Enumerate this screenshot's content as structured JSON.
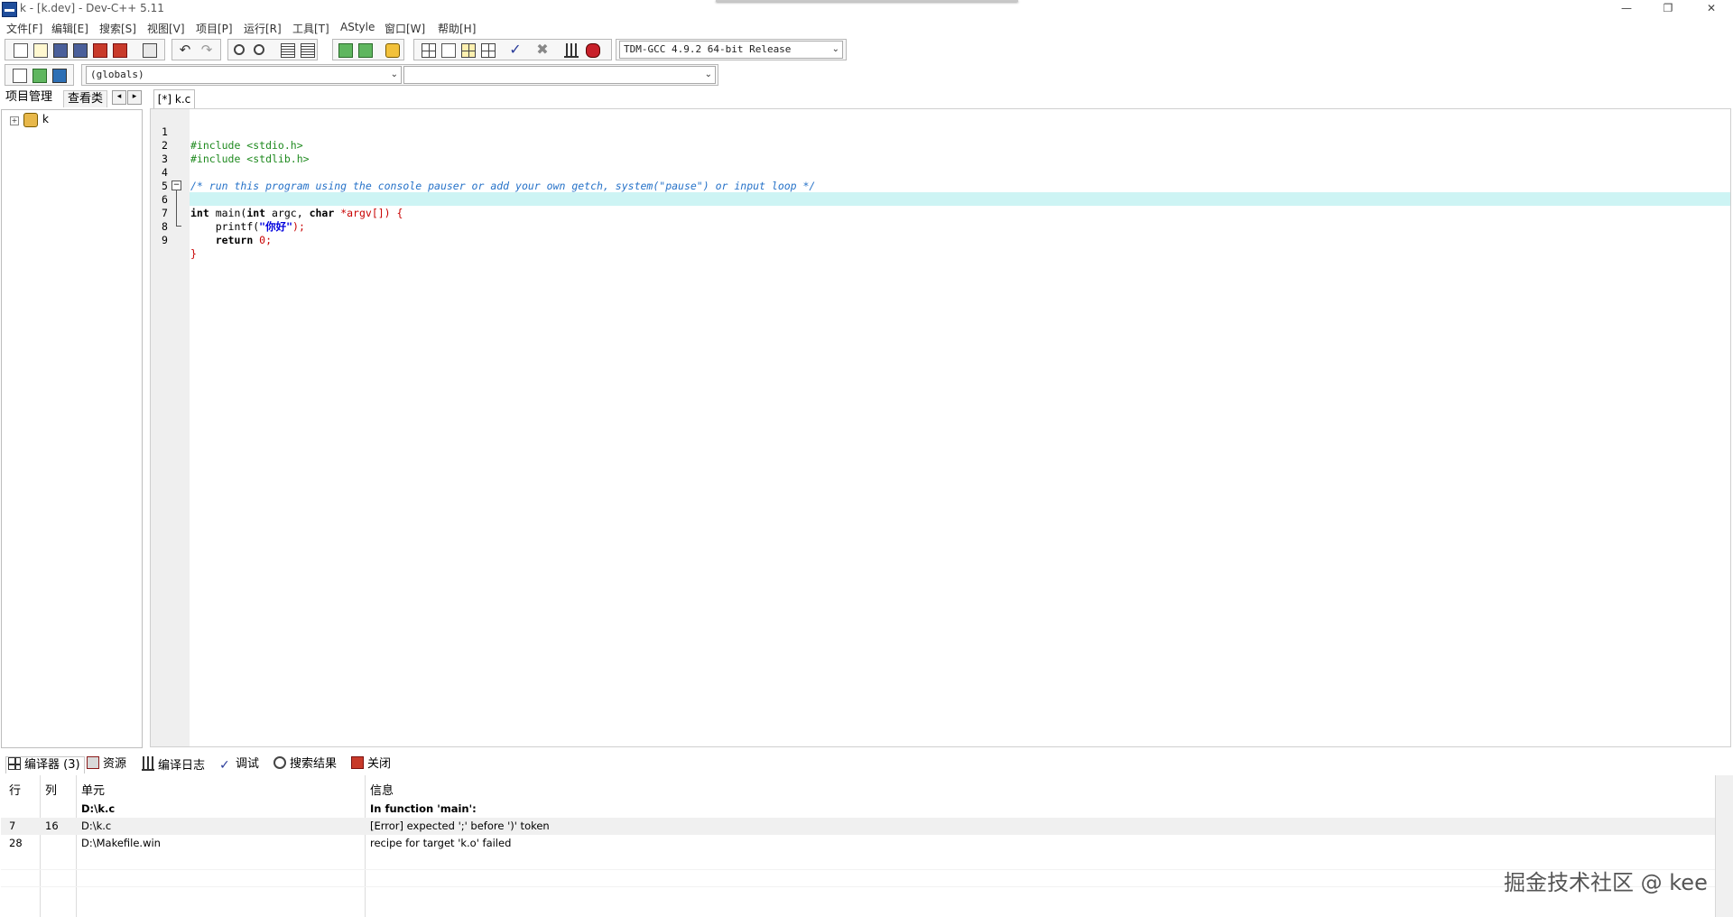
{
  "window": {
    "title": "k - [k.dev] - Dev-C++ 5.11",
    "minimize": "—",
    "restore": "❐",
    "close": "✕"
  },
  "menu": [
    "文件[F]",
    "编辑[E]",
    "搜索[S]",
    "视图[V]",
    "项目[P]",
    "运行[R]",
    "工具[T]",
    "AStyle",
    "窗口[W]",
    "帮助[H]"
  ],
  "toolbar": {
    "compiler_select": "TDM-GCC 4.9.2 64-bit Release",
    "class_select": "(globals)",
    "member_select": ""
  },
  "left_panel": {
    "tabs": [
      "项目管理",
      "查看类"
    ],
    "nav_prev": "◂",
    "nav_next": "▸",
    "tree": {
      "expander": "+",
      "project": "k"
    }
  },
  "editor": {
    "tab": "[*] k.c",
    "line_numbers": [
      "1",
      "2",
      "3",
      "4",
      "5",
      "6",
      "7",
      "8",
      "9"
    ],
    "lines": {
      "l1": "#include <stdio.h>",
      "l2": "#include <stdlib.h>",
      "l4": "/* run this program using the console pauser or add your own getch, system(\"pause\") or input loop */",
      "l6_kw1": "int",
      "l6_a": " main(",
      "l6_kw2": "int",
      "l6_b": " argc, ",
      "l6_kw3": "char",
      "l6_c": " *argv[]) {",
      "l7_indent": "    ",
      "l7_fn": "printf(",
      "l7_str": "\"你好\"",
      "l7_end": ");",
      "l8_indent": "    ",
      "l8_kw": "return",
      "l8_num": " 0;",
      "l9": "}"
    },
    "fold_marker": "−"
  },
  "bottom_panel": {
    "tabs": [
      "编译器 (3)",
      "资源",
      "编译日志",
      "调试",
      "搜索结果",
      "关闭"
    ],
    "columns": [
      "行",
      "列",
      "单元",
      "信息"
    ],
    "rows": [
      {
        "line": "",
        "col": "",
        "unit": "D:\\k.c",
        "message": "In function 'main':"
      },
      {
        "line": "7",
        "col": "16",
        "unit": "D:\\k.c",
        "message": "[Error] expected ';' before ')' token"
      },
      {
        "line": "28",
        "col": "",
        "unit": "D:\\Makefile.win",
        "message": "recipe for target 'k.o' failed"
      }
    ]
  },
  "watermark": "掘金技术社区 @ kee",
  "colors": {
    "current_line": "#cdf4f4",
    "preprocessor": "#1f8a1f",
    "comment": "#2672c8",
    "string": "#0000dd",
    "symbol": "#c80000"
  }
}
